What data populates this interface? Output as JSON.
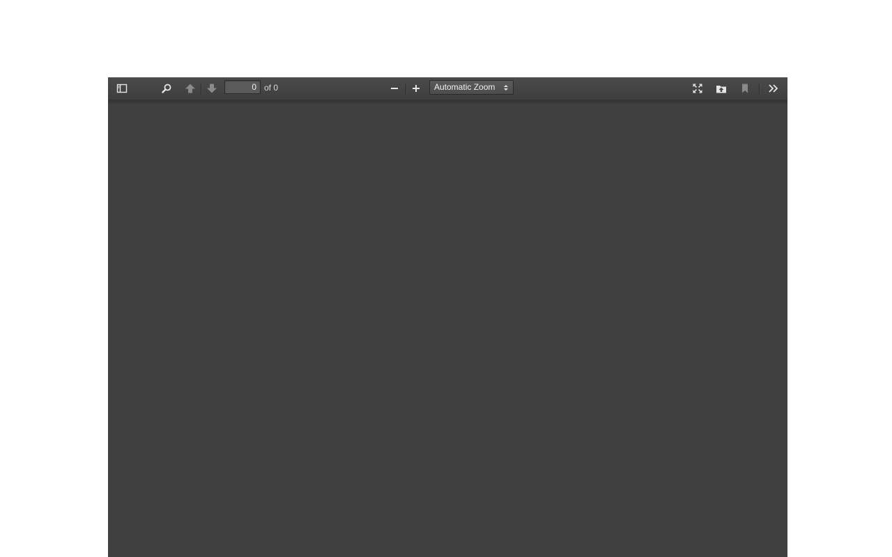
{
  "toolbar": {
    "page_number_value": "0",
    "page_count_label": "of 0",
    "zoom_selected": "Automatic Zoom",
    "icons": {
      "sidebar_toggle": "sidebar-toggle-icon",
      "find": "search-icon",
      "previous_page": "arrow-up-icon",
      "next_page": "arrow-down-icon",
      "zoom_out": "minus-icon",
      "zoom_in": "plus-icon",
      "presentation_mode": "fullscreen-icon",
      "open_file": "open-file-icon",
      "bookmark": "bookmark-icon",
      "tools": "double-chevron-right-icon"
    }
  },
  "colors": {
    "toolbar_bg": "#474747",
    "viewer_bg": "#404040",
    "page_bg": "#ffffff",
    "icon_active": "#e6e6e6",
    "icon_disabled": "#8a8a8a"
  }
}
